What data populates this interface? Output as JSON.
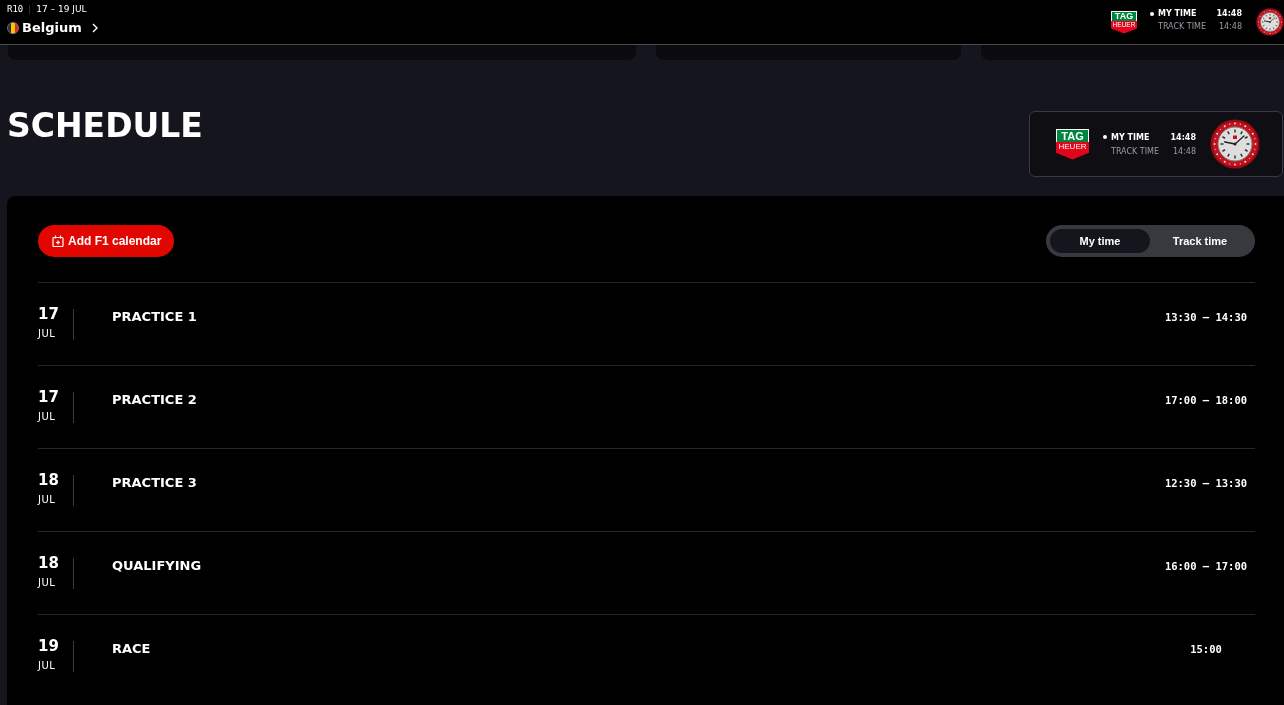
{
  "header": {
    "round": "R10",
    "dates": "17 – 19 JUL",
    "country": "Belgium",
    "logo": {
      "top": "TAG",
      "bottom": "HEUER"
    },
    "times": [
      {
        "label": "MY TIME",
        "value": "14:48",
        "selected": true
      },
      {
        "label": "TRACK TIME",
        "value": "14:48",
        "selected": false
      }
    ]
  },
  "title": "SCHEDULE",
  "time_card": {
    "logo": {
      "top": "TAG",
      "bottom": "HEUER"
    },
    "times": [
      {
        "label": "MY TIME",
        "value": "14:48",
        "selected": true
      },
      {
        "label": "TRACK TIME",
        "value": "14:48",
        "selected": false
      }
    ]
  },
  "schedule": {
    "add_button": "Add F1 calendar",
    "toggle": [
      {
        "label": "My time",
        "selected": true
      },
      {
        "label": "Track time",
        "selected": false
      }
    ],
    "sessions": [
      {
        "day": "17",
        "month": "JUL",
        "name": "PRACTICE 1",
        "time": "13:30 – 14:30"
      },
      {
        "day": "17",
        "month": "JUL",
        "name": "PRACTICE 2",
        "time": "17:00 – 18:00"
      },
      {
        "day": "18",
        "month": "JUL",
        "name": "PRACTICE 3",
        "time": "12:30 – 13:30"
      },
      {
        "day": "18",
        "month": "JUL",
        "name": "QUALIFYING",
        "time": "16:00 – 17:00"
      },
      {
        "day": "19",
        "month": "JUL",
        "name": "RACE",
        "time": "15:00"
      }
    ]
  }
}
